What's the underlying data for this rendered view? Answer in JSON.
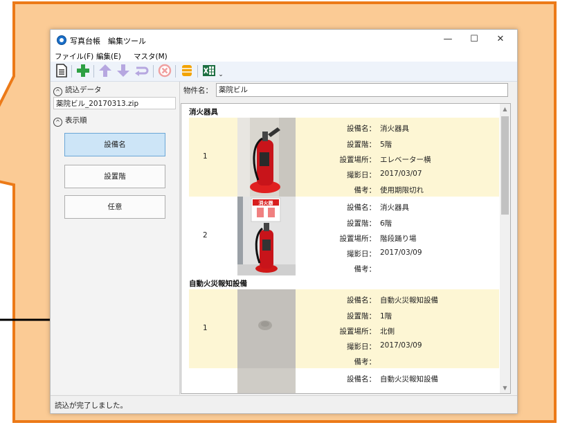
{
  "window": {
    "title": "写真台帳　編集ツール",
    "controls": {
      "minimize": "—",
      "maximize": "☐",
      "close": "✕"
    }
  },
  "menu": [
    "ファイル(F)",
    "編集(E)",
    "マスタ(M)"
  ],
  "toolbar": {
    "icons": [
      "document-icon",
      "add-icon",
      "arrow-up-icon",
      "arrow-down-icon",
      "return-arrow-icon",
      "delete-icon",
      "database-icon",
      "excel-icon",
      "toolbar-overflow-icon"
    ],
    "overflow": "⌄"
  },
  "left_panel": {
    "load_header": "読込データ",
    "file_name": "薬院ビル_20170313.zip",
    "order_header": "表示順",
    "sort_buttons": [
      "設備名",
      "設置階",
      "任意"
    ],
    "active_sort": "設備名"
  },
  "right_panel": {
    "property_label": "物件名：",
    "property_value": "薬院ビル",
    "groups": [
      {
        "name": "消火器具",
        "rows": [
          {
            "num": "1",
            "fields": [
              {
                "k": "設備名：",
                "v": "消火器具"
              },
              {
                "k": "設置階：",
                "v": "5階"
              },
              {
                "k": "設置場所：",
                "v": "エレベーター横"
              },
              {
                "k": "撮影日：",
                "v": "2017/03/07"
              },
              {
                "k": "備考：",
                "v": "使用期限切れ"
              }
            ]
          },
          {
            "num": "2",
            "fields": [
              {
                "k": "設備名：",
                "v": "消火器具"
              },
              {
                "k": "設置階：",
                "v": "6階"
              },
              {
                "k": "設置場所：",
                "v": "階段踊り場"
              },
              {
                "k": "撮影日：",
                "v": "2017/03/09"
              },
              {
                "k": "備考：",
                "v": ""
              }
            ]
          }
        ]
      },
      {
        "name": "自動火災報知設備",
        "rows": [
          {
            "num": "1",
            "fields": [
              {
                "k": "設備名：",
                "v": "自動火災報知設備"
              },
              {
                "k": "設置階：",
                "v": "1階"
              },
              {
                "k": "設置場所：",
                "v": "北側"
              },
              {
                "k": "撮影日：",
                "v": "2017/03/09"
              },
              {
                "k": "備考：",
                "v": ""
              }
            ]
          },
          {
            "num": "",
            "fields": [
              {
                "k": "設備名：",
                "v": "自動火災報知設備"
              }
            ]
          }
        ]
      }
    ]
  },
  "sign_text": "消火器",
  "status_text": "読込が完了しました。",
  "colors": {
    "callout_fill": "#fbcb95",
    "callout_stroke": "#ec7a18",
    "row_highlight": "#fdf6d4",
    "active_button": "#cde5f7"
  }
}
